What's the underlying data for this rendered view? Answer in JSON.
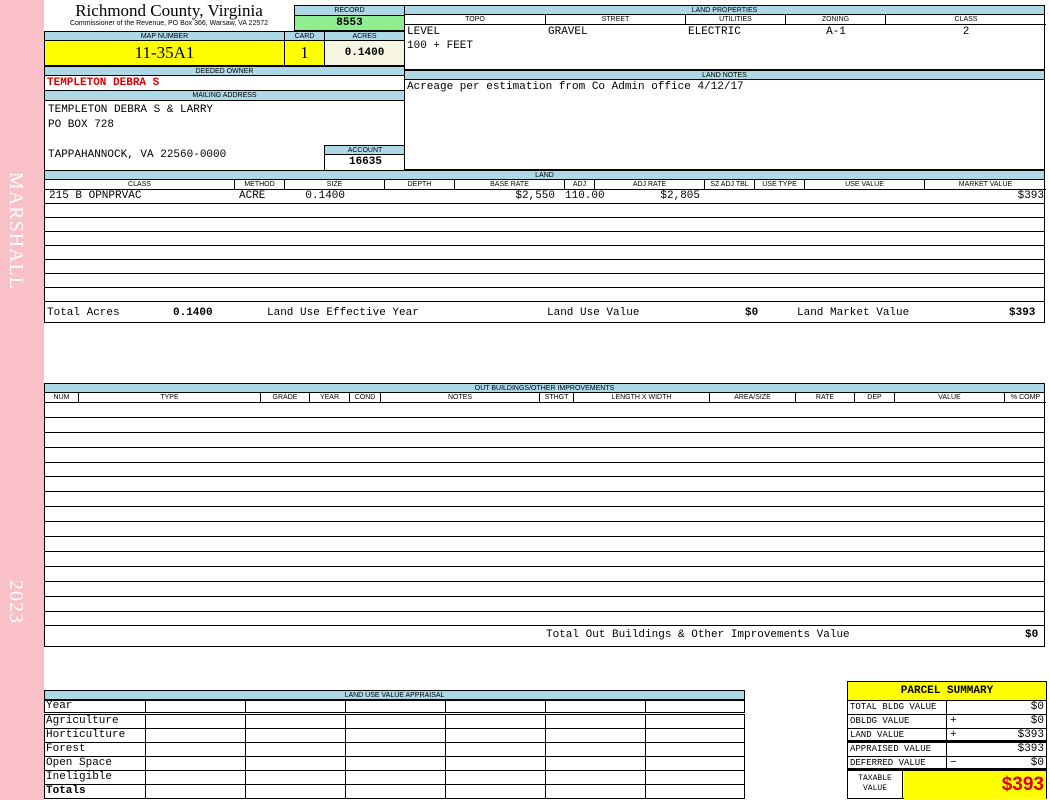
{
  "sidebar": {
    "district": "MARSHALL",
    "year": "2023"
  },
  "header": {
    "county": "Richmond County, Virginia",
    "office": "Commissioner of the Revenue, PO Box 366, Warsaw, VA 22572"
  },
  "record": {
    "label": "RECORD",
    "value": "8553"
  },
  "map": {
    "map_label": "MAP NUMBER",
    "map_value": "11-35A1",
    "card_label": "CARD",
    "card_value": "1",
    "acres_label": "ACRES",
    "acres_value": "0.1400"
  },
  "owner": {
    "label": "DEEDED OWNER",
    "name": "TEMPLETON DEBRA S"
  },
  "mailing": {
    "label": "MAILING ADDRESS",
    "line1": "TEMPLETON DEBRA S & LARRY",
    "line2": "PO BOX 728",
    "line3": "TAPPAHANNOCK, VA 22560-0000"
  },
  "account": {
    "label": "ACCOUNT",
    "value": "16635"
  },
  "land_properties": {
    "label": "LAND PROPERTIES",
    "columns": [
      "TOPO",
      "STREET",
      "UTILITIES",
      "ZONING",
      "CLASS"
    ],
    "values": [
      "LEVEL",
      "GRAVEL",
      "ELECTRIC",
      "A-1",
      "2"
    ],
    "topo2": "100 + FEET"
  },
  "land_notes": {
    "label": "LAND NOTES",
    "text": "Acreage per estimation from Co Admin office 4/12/17"
  },
  "land": {
    "label": "LAND",
    "columns": [
      "CLASS",
      "METHOD",
      "SIZE",
      "DEPTH",
      "BASE RATE",
      "ADJ",
      "ADJ RATE",
      "SZ ADJ TBL",
      "USE TYPE",
      "USE VALUE",
      "MARKET VALUE"
    ],
    "rows": [
      [
        "215 B OPNPRVAC",
        "ACRE",
        "0.1400",
        "",
        "$2,550",
        "110.00",
        "$2,805",
        "",
        "",
        "",
        "$393"
      ]
    ],
    "totals": {
      "acres_label": "Total Acres",
      "acres": "0.1400",
      "eff_year_label": "Land Use Effective Year",
      "use_value_label": "Land Use Value",
      "use_value": "$0",
      "market_label": "Land Market Value",
      "market": "$393"
    }
  },
  "outbuildings": {
    "label": "OUT BUILDINGS/OTHER IMPROVEMENTS",
    "columns": [
      "NUM",
      "TYPE",
      "GRADE",
      "YEAR",
      "COND",
      "NOTES",
      "STHGT",
      "LENGTH X WIDTH",
      "AREA/SIZE",
      "RATE",
      "DEP",
      "VALUE",
      "% COMP"
    ],
    "total_label": "Total Out Buildings & Other Improvements Value",
    "total": "$0"
  },
  "land_use": {
    "label": "LAND USE VALUE APPRAISAL",
    "year_label": "Year",
    "rows": [
      "Agriculture",
      "Horticulture",
      "Forest",
      "Open Space",
      "Ineligible"
    ],
    "totals_label": "Totals"
  },
  "summary": {
    "title": "PARCEL SUMMARY",
    "rows": [
      {
        "label": "TOTAL BLDG VALUE",
        "op": "",
        "value": "$0"
      },
      {
        "label": "OBLDG VALUE",
        "op": "+",
        "value": "$0"
      },
      {
        "label": "LAND VALUE",
        "op": "+",
        "value": "$393"
      },
      {
        "label": "APPRAISED VALUE",
        "op": "",
        "value": "$393"
      },
      {
        "label": "DEFERRED VALUE",
        "op": "−",
        "value": "$0"
      }
    ],
    "taxable_label": "TAXABLE VALUE",
    "taxable": "$393"
  },
  "colors": {
    "header_blue": "#add8e6",
    "yellow": "#ffff00",
    "green": "#90ee90",
    "pink": "#f9c0c8",
    "red": "#e00000"
  }
}
